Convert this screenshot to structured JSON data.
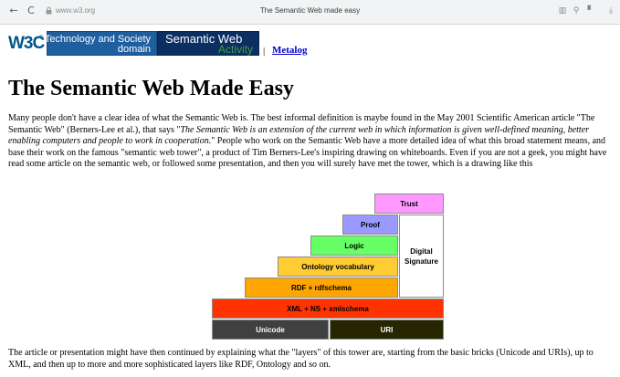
{
  "browser": {
    "back_icon": "←",
    "reload_icon": "C",
    "url": "www.w3.org",
    "tab_title": "The Semantic Web made easy",
    "right_icons": [
      "reader-icon",
      "search-icon",
      "bookmark-icon",
      "download-icon"
    ],
    "right_glyphs": [
      "▥",
      "⚲",
      "▘",
      "⤓"
    ]
  },
  "header": {
    "w3c_logo": "W3C",
    "w3c_reg": "®",
    "tech_society_line1": "Technology and Society",
    "tech_society_line2": "domain",
    "semantic_web_line1": "Semantic Web",
    "semantic_web_line2": "Activity",
    "separator": "|",
    "metalog_link": "Metalog"
  },
  "main": {
    "title": "The Semantic Web Made Easy",
    "para1_a": "Many people don't have a clear idea of what the Semantic Web is. The best informal definition is maybe found in the May 2001 Scientific American article \"The Semantic Web\" (Berners-Lee et al.), that says \"",
    "para1_quote": "The Semantic Web is an extension of the current web in which information is given well-defined meaning, better enabling computers and people to work in cooperation.",
    "para1_b": "\" People who work on the Semantic Web have a more detailed idea of what this broad statement means, and base their work on the famous \"semantic web tower\", a product of Tim Berners-Lee's inspiring drawing on whiteboards. Even if you are not a geek, you might have read some article on the semantic web, or followed some presentation, and then you will surely have met the tower, which is a drawing like this",
    "para2": "The article or presentation might have then continued by explaining what the \"layers\" of this tower are, starting from the basic bricks (Unicode and URIs), up to XML, and then up to more and more sophisticated layers like RDF, Ontology and so on."
  },
  "tower": {
    "trust": "Trust",
    "proof": "Proof",
    "logic": "Logic",
    "digital_signature_line1": "Digital",
    "digital_signature_line2": "Signature",
    "ontology": "Ontology vocabulary",
    "rdf": "RDF + rdfschema",
    "xml": "XML + NS + xmlschema",
    "unicode": "Unicode",
    "uri": "URI",
    "colors": {
      "trust": "#ff99ff",
      "proof": "#9999ff",
      "logic": "#66ff66",
      "digital_signature": "#ffffff",
      "ontology": "#ffcc33",
      "rdf": "#ffa500",
      "xml": "#ff3300",
      "unicode": "#404040",
      "uri": "#262600"
    }
  }
}
